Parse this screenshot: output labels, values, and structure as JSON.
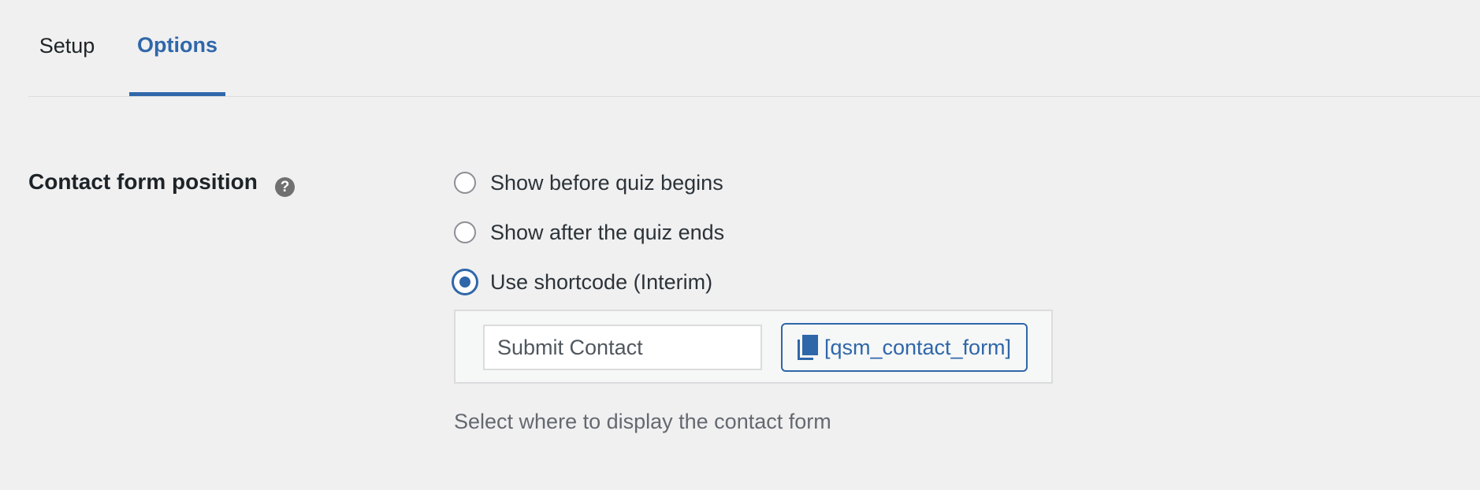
{
  "tabs": [
    {
      "label": "Setup",
      "active": false
    },
    {
      "label": "Options",
      "active": true
    }
  ],
  "field": {
    "label": "Contact form position",
    "help_icon": "question-mark-icon",
    "help_glyph": "?"
  },
  "options": [
    {
      "label": "Show before quiz begins",
      "checked": false
    },
    {
      "label": "Show after the quiz ends",
      "checked": false
    },
    {
      "label": "Use shortcode (Interim)",
      "checked": true
    }
  ],
  "shortcode": {
    "input_value": "Submit Contact",
    "copy_label": "[qsm_contact_form]",
    "copy_icon": "copy-icon"
  },
  "description": "Select where to display the contact form",
  "colors": {
    "accent": "#2f67a9",
    "background": "#f0f0f1",
    "text": "#1d2327",
    "muted": "#646970"
  }
}
